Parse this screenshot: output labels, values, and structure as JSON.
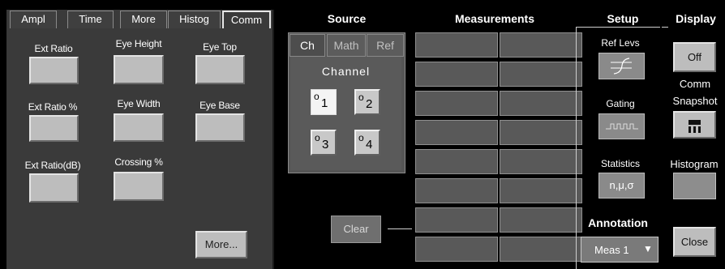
{
  "tabs": [
    {
      "label": "Ampl"
    },
    {
      "label": "Time"
    },
    {
      "label": "More"
    },
    {
      "label": "Histog"
    },
    {
      "label": "Comm"
    }
  ],
  "measurements": {
    "ext_ratio": "Ext Ratio",
    "eye_height": "Eye Height",
    "eye_top": "Eye Top",
    "ext_ratio_pct": "Ext Ratio %",
    "eye_width": "Eye Width",
    "eye_base": "Eye Base",
    "ext_ratio_db": "Ext Ratio(dB)",
    "crossing_pct": "Crossing %",
    "more_label": "More..."
  },
  "source": {
    "title": "Source",
    "tabs": [
      "Ch",
      "Math",
      "Ref"
    ],
    "channel_label": "Channel",
    "channels": [
      "1",
      "2",
      "3",
      "4"
    ],
    "channel_glyph": "o",
    "selected_channel": "1"
  },
  "measurements_panel": {
    "title": "Measurements",
    "clear_label": "Clear"
  },
  "setup": {
    "title": "Setup",
    "ref_levs": "Ref Levs",
    "gating": "Gating",
    "statistics": "Statistics",
    "statistics_glyph": "n,μ,σ",
    "annotation_title": "Annotation",
    "annotation_value": "Meas 1",
    "annotation_arrow": "▼"
  },
  "display": {
    "title": "Display",
    "off_label": "Off",
    "comm_label": "Comm",
    "snapshot_label": "Snapshot",
    "histogram_label": "Histogram",
    "close_label": "Close"
  },
  "colors": {
    "panel_bg": "#3a3a3a",
    "button_face": "#bdbdbd",
    "grid_cell": "#595959",
    "background": "#000000"
  }
}
